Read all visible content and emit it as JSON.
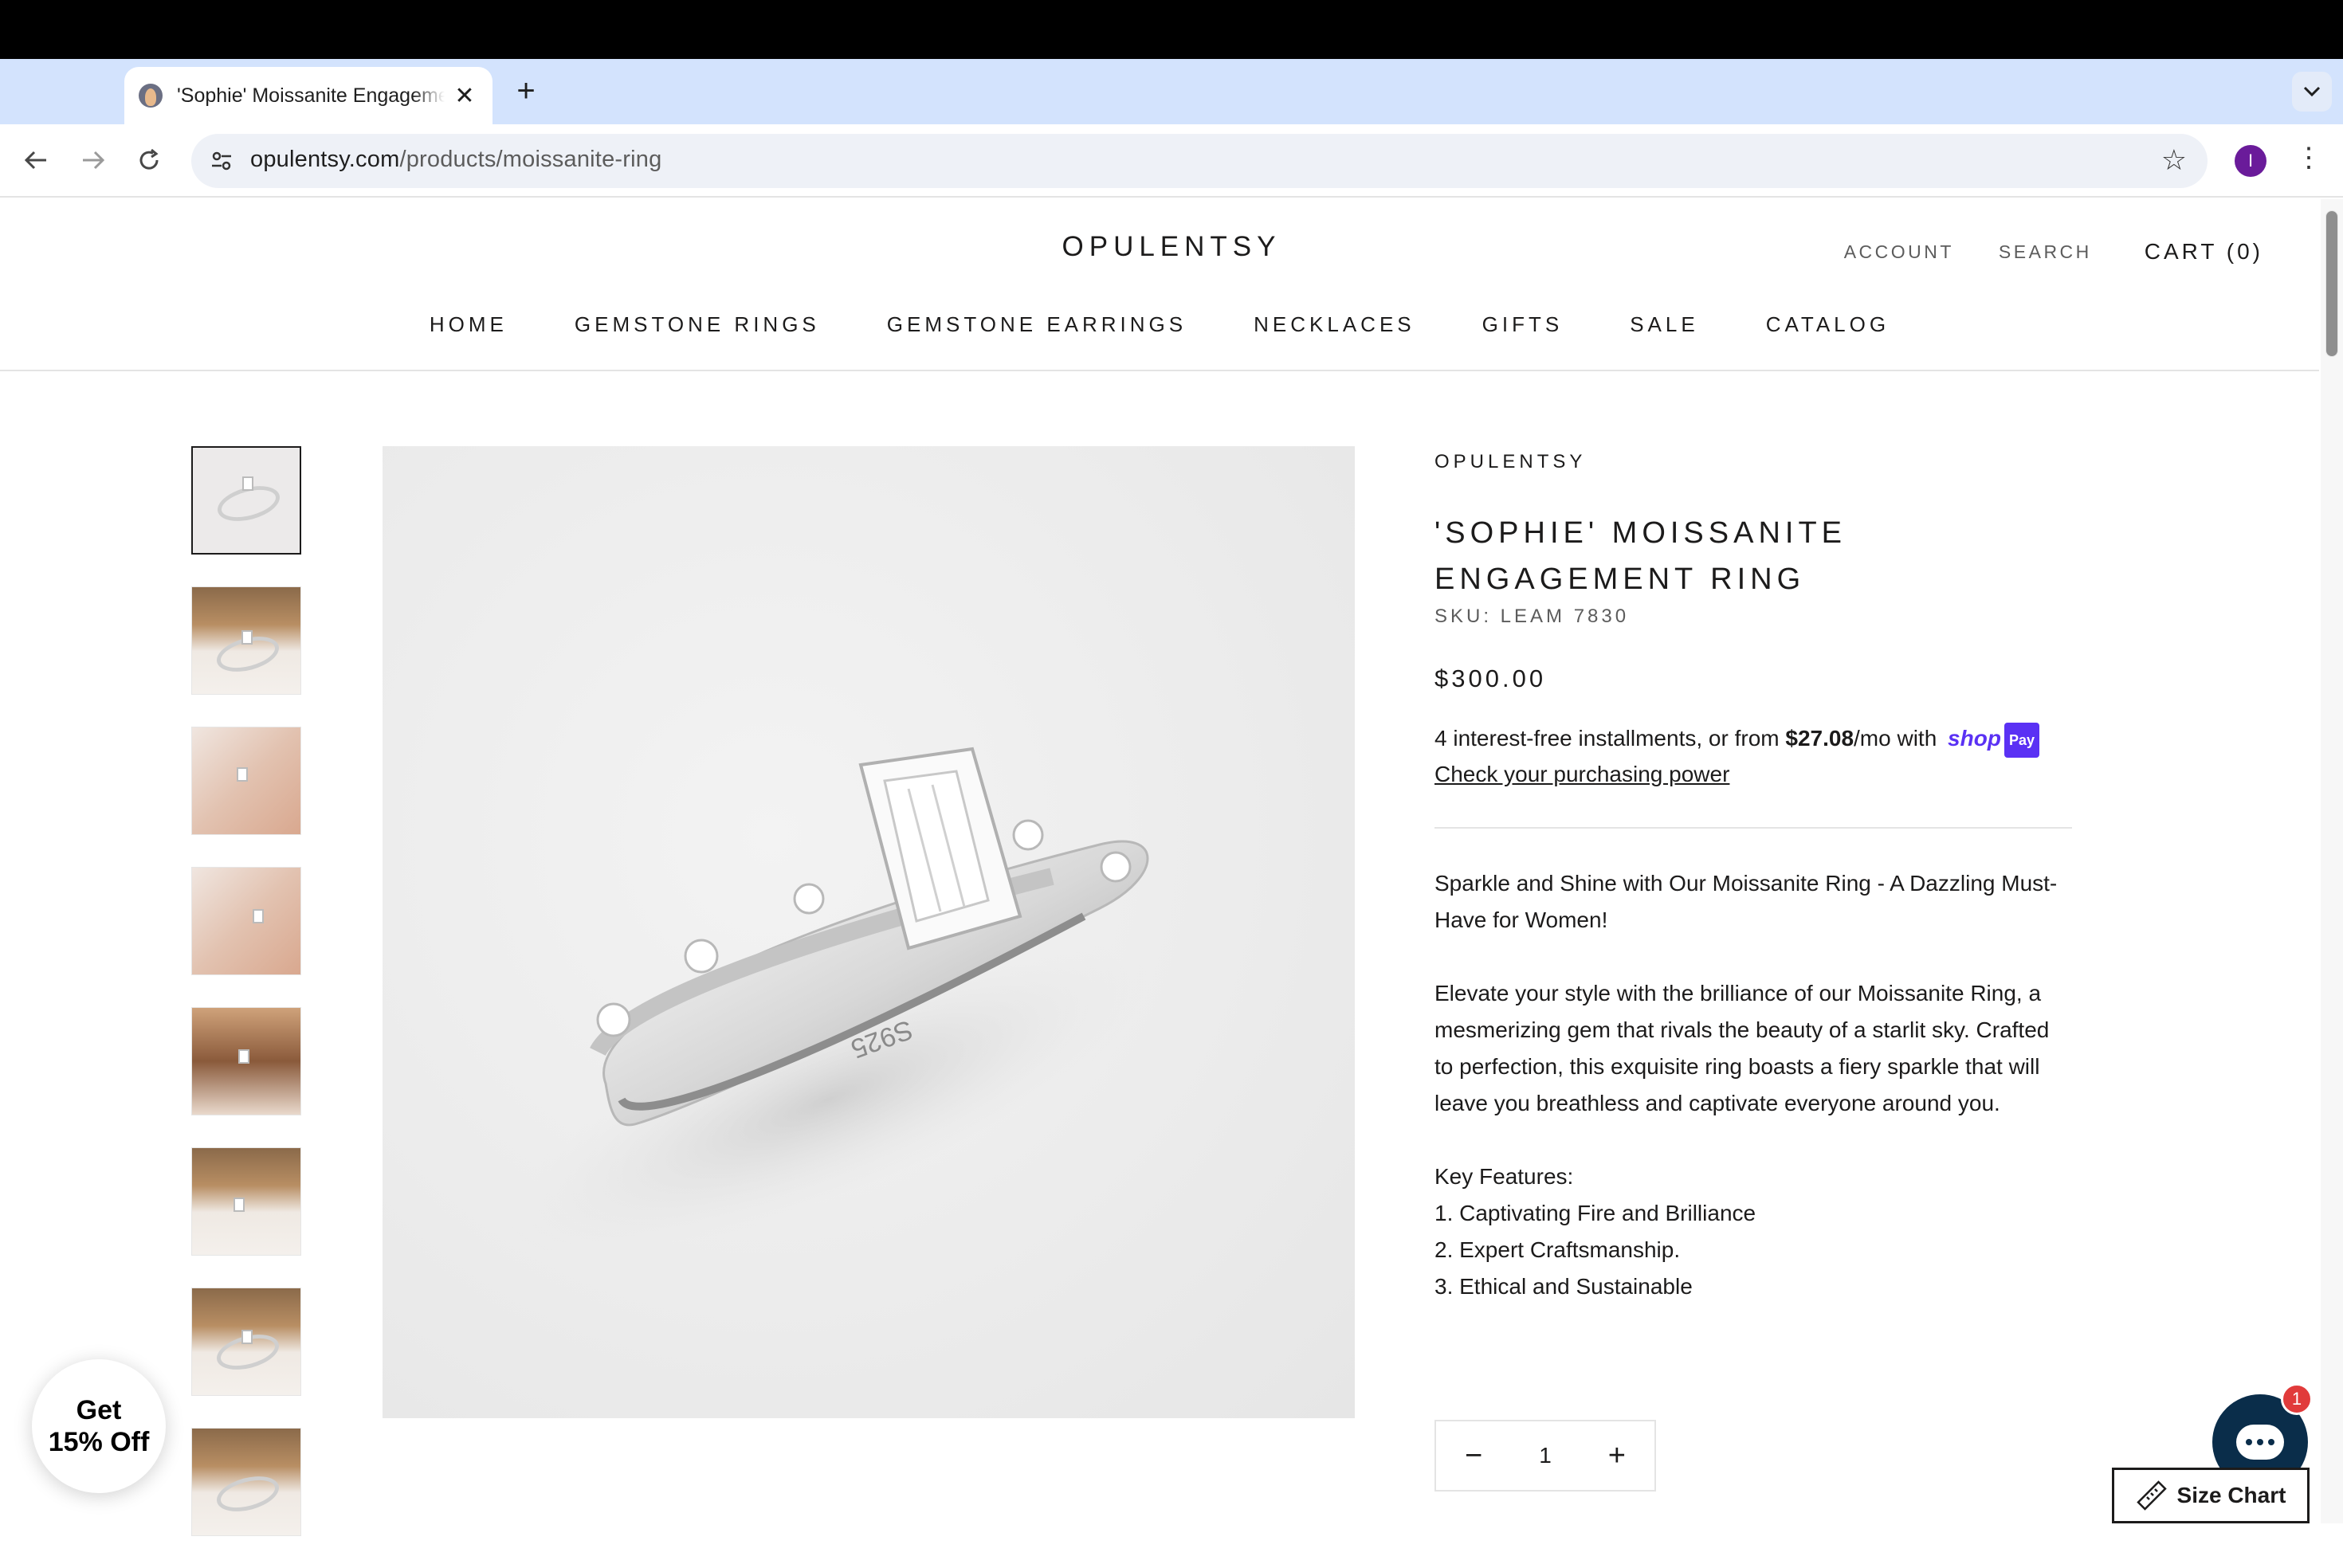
{
  "browser": {
    "tab_title": "'Sophie' Moissanite Engagement Ring",
    "tab_close": "✕",
    "new_tab": "+",
    "tab_list": "⌄",
    "url_domain": "opulentsy.com",
    "url_path": "/products/moissanite-ring",
    "avatar_letter": "I",
    "back": "←",
    "forward": "→",
    "reload": "↻",
    "star": "☆",
    "menu": "⋮"
  },
  "header": {
    "logo": "OPULENTSY",
    "account": "ACCOUNT",
    "search": "SEARCH",
    "cart": "CART (0)"
  },
  "nav": {
    "items": [
      "HOME",
      "GEMSTONE RINGS",
      "GEMSTONE EARRINGS",
      "NECKLACES",
      "GIFTS",
      "SALE",
      "CATALOG"
    ]
  },
  "product": {
    "vendor": "OPULENTSY",
    "title": "'SOPHIE' MOISSANITE ENGAGEMENT RING",
    "sku": "SKU: LEAM 7830",
    "price": "$300.00",
    "installments_prefix": "4 interest-free installments, or from ",
    "installments_amount": "$27.08",
    "installments_suffix": "/mo with ",
    "shop_label": "shop",
    "pay_label": "Pay",
    "check_link": "Check your purchasing power",
    "desc_intro": "Sparkle and Shine with Our Moissanite Ring - A Dazzling Must-Have for Women!",
    "desc_body": "Elevate your style with the brilliance of our Moissanite Ring, a mesmerizing gem that rivals the beauty of a starlit sky. Crafted to perfection, this exquisite ring boasts a fiery sparkle that will leave you breathless and captivate everyone around you.",
    "features_heading": "Key Features:",
    "features": [
      "1. Captivating Fire and Brilliance",
      "2. Expert Craftsmanship.",
      "3. Ethical and Sustainable"
    ],
    "quantity": "1",
    "qty_minus": "−",
    "qty_plus": "+",
    "ring_engraving": "S925"
  },
  "floating": {
    "promo_line1": "Get",
    "promo_line2": "15% Off",
    "chat_badge": "1",
    "size_chart": "Size Chart"
  },
  "colors": {
    "accent_shop": "#5a31f4",
    "text": "#1c1b1b",
    "chat_bg": "#0a2d4a",
    "badge": "#e13b3b",
    "tab_strip": "#d3e3fd"
  }
}
